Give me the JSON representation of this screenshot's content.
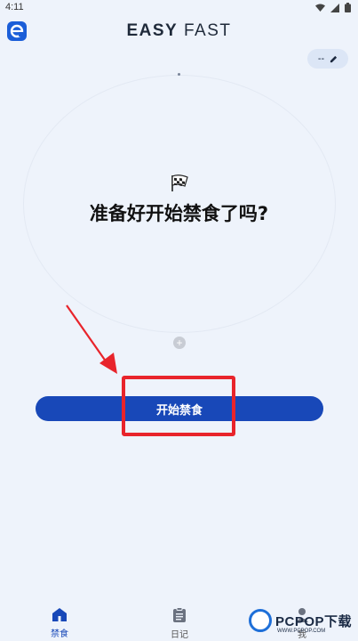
{
  "status_bar": {
    "time": "4:11",
    "icons": [
      "wifi-icon",
      "signal-icon",
      "battery-icon"
    ]
  },
  "header": {
    "logo_letter": "e",
    "title_bold": "EASY",
    "title_light": "FAST"
  },
  "edit_chip": {
    "value": "--",
    "icon": "pencil-icon"
  },
  "main": {
    "icon": "checkered-flag-icon",
    "prompt": "准备好开始禁食了吗?",
    "start_button_label": "开始禁食"
  },
  "bottom_nav": {
    "items": [
      {
        "label": "禁食",
        "icon": "home-icon",
        "active": true
      },
      {
        "label": "日记",
        "icon": "clipboard-icon",
        "active": false
      },
      {
        "label": "我",
        "icon": "profile-icon",
        "active": false
      }
    ]
  },
  "watermark": {
    "brand": "PCPOP下载",
    "sub": "WWW.PCPOP.COM"
  },
  "colors": {
    "accent": "#1848b8",
    "background": "#eef3fb",
    "highlight": "#e8242b"
  }
}
